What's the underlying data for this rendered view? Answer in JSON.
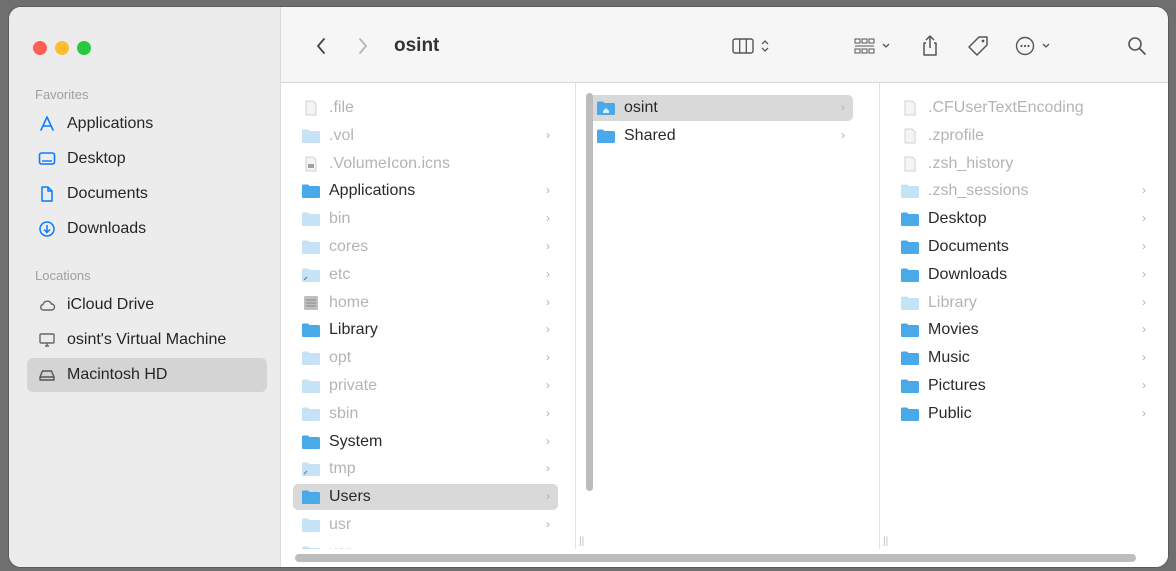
{
  "window": {
    "title": "osint"
  },
  "sidebar": {
    "favorites_label": "Favorites",
    "favorites": [
      {
        "label": "Applications",
        "icon": "applications-icon"
      },
      {
        "label": "Desktop",
        "icon": "desktop-icon"
      },
      {
        "label": "Documents",
        "icon": "document-icon"
      },
      {
        "label": "Downloads",
        "icon": "download-icon"
      }
    ],
    "locations_label": "Locations",
    "locations": [
      {
        "label": "iCloud Drive",
        "icon": "cloud-icon"
      },
      {
        "label": "osint's Virtual Machine",
        "icon": "computer-icon"
      },
      {
        "label": "Macintosh HD",
        "icon": "disk-icon",
        "selected": true
      }
    ]
  },
  "toolbar": {
    "back": "back-icon",
    "forward": "forward-icon",
    "title": "osint",
    "view": "columns-view-icon",
    "group": "group-icon",
    "share": "share-icon",
    "tag": "tag-icon",
    "more": "more-icon",
    "search": "search-icon"
  },
  "columns": [
    {
      "items": [
        {
          "name": ".file",
          "kind": "file",
          "dim": true,
          "chevron": false
        },
        {
          "name": ".vol",
          "kind": "folder",
          "dim": true,
          "chevron": true
        },
        {
          "name": ".VolumeIcon.icns",
          "kind": "icns",
          "dim": true,
          "chevron": false
        },
        {
          "name": "Applications",
          "kind": "folder",
          "dim": false,
          "chevron": true
        },
        {
          "name": "bin",
          "kind": "folder",
          "dim": true,
          "chevron": true
        },
        {
          "name": "cores",
          "kind": "folder",
          "dim": true,
          "chevron": true
        },
        {
          "name": "etc",
          "kind": "alias-folder",
          "dim": true,
          "chevron": true
        },
        {
          "name": "home",
          "kind": "server",
          "dim": true,
          "chevron": true
        },
        {
          "name": "Library",
          "kind": "folder",
          "dim": false,
          "chevron": true
        },
        {
          "name": "opt",
          "kind": "folder",
          "dim": true,
          "chevron": true
        },
        {
          "name": "private",
          "kind": "folder",
          "dim": true,
          "chevron": true
        },
        {
          "name": "sbin",
          "kind": "folder",
          "dim": true,
          "chevron": true
        },
        {
          "name": "System",
          "kind": "folder",
          "dim": false,
          "chevron": true
        },
        {
          "name": "tmp",
          "kind": "alias-folder",
          "dim": true,
          "chevron": true
        },
        {
          "name": "Users",
          "kind": "folder",
          "dim": false,
          "chevron": true,
          "selected": true
        },
        {
          "name": "usr",
          "kind": "folder",
          "dim": true,
          "chevron": true
        },
        {
          "name": "var",
          "kind": "alias-folder",
          "dim": true,
          "chevron": true
        }
      ]
    },
    {
      "items": [
        {
          "name": "osint",
          "kind": "home-folder",
          "dim": false,
          "chevron": true,
          "selected": true
        },
        {
          "name": "Shared",
          "kind": "folder",
          "dim": false,
          "chevron": true
        }
      ]
    },
    {
      "items": [
        {
          "name": ".CFUserTextEncoding",
          "kind": "file",
          "dim": true,
          "chevron": false
        },
        {
          "name": ".zprofile",
          "kind": "file",
          "dim": true,
          "chevron": false
        },
        {
          "name": ".zsh_history",
          "kind": "file",
          "dim": true,
          "chevron": false
        },
        {
          "name": ".zsh_sessions",
          "kind": "folder",
          "dim": true,
          "chevron": true
        },
        {
          "name": "Desktop",
          "kind": "folder",
          "dim": false,
          "chevron": true
        },
        {
          "name": "Documents",
          "kind": "folder",
          "dim": false,
          "chevron": true
        },
        {
          "name": "Downloads",
          "kind": "folder",
          "dim": false,
          "chevron": true
        },
        {
          "name": "Library",
          "kind": "folder",
          "dim": true,
          "chevron": true
        },
        {
          "name": "Movies",
          "kind": "folder",
          "dim": false,
          "chevron": true
        },
        {
          "name": "Music",
          "kind": "folder",
          "dim": false,
          "chevron": true
        },
        {
          "name": "Pictures",
          "kind": "folder",
          "dim": false,
          "chevron": true
        },
        {
          "name": "Public",
          "kind": "folder",
          "dim": false,
          "chevron": true
        }
      ]
    }
  ],
  "colors": {
    "folder": "#4aa8e8",
    "folder_dim": "#c5e2f6",
    "accent": "#0a7cff"
  }
}
